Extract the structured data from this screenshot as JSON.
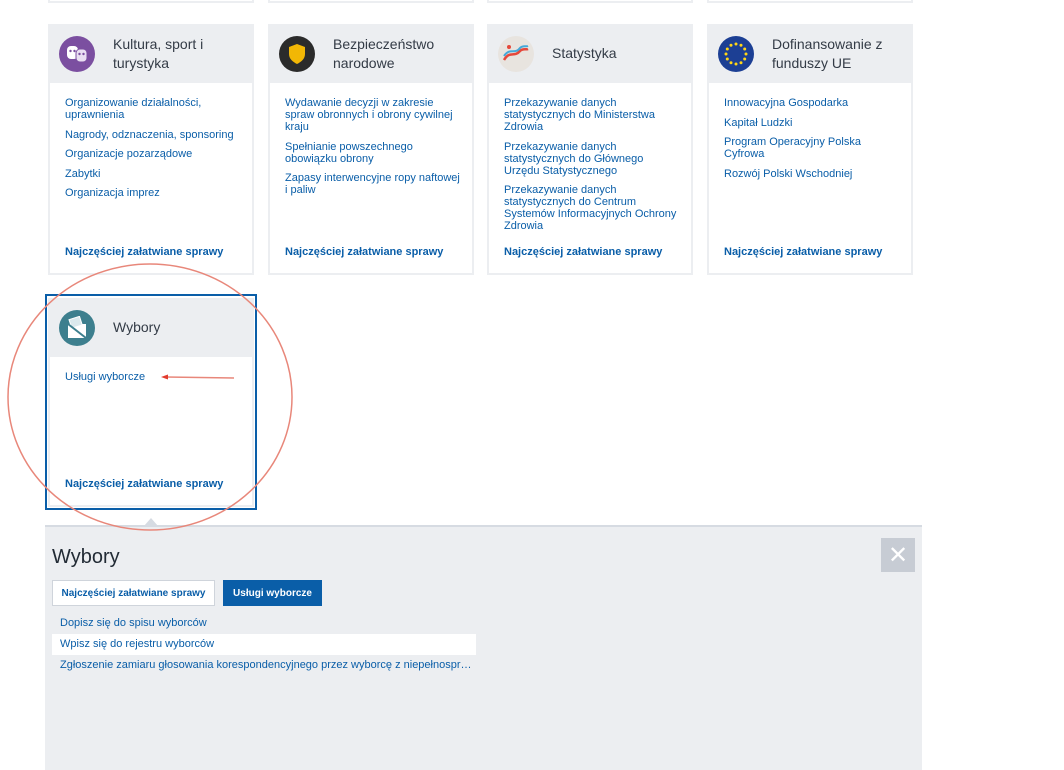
{
  "categories": [
    {
      "title": "Kultura, sport i turystyka",
      "icon": "theater-masks-icon",
      "icon_color": "#7b4fa0",
      "links": [
        "Organizowanie działalności, uprawnienia",
        "Nagrody, odznaczenia, sponsoring",
        "Organizacje pozarządowe",
        "Zabytki",
        "Organizacja imprez"
      ],
      "footer": "Najczęściej załatwiane sprawy"
    },
    {
      "title": "Bezpieczeństwo narodowe",
      "icon": "shield-icon",
      "icon_color": "#2b2b2b",
      "links": [
        "Wydawanie decyzji w zakresie spraw obronnych i obrony cywilnej kraju",
        "Spełnianie powszechnego obowiązku obrony",
        "Zapasy interwencyjne ropy naftowej i paliw"
      ],
      "footer": "Najczęściej załatwiane sprawy"
    },
    {
      "title": "Statystyka",
      "icon": "chart-lines-icon",
      "icon_color": "#e8e4df",
      "links": [
        "Przekazywanie danych statystycznych do Ministerstwa Zdrowia",
        "Przekazywanie danych statystycznych do Głównego Urzędu Statystycznego",
        "Przekazywanie danych statystycznych do Centrum Systemów Informacyjnych Ochrony Zdrowia"
      ],
      "footer": "Najczęściej załatwiane sprawy"
    },
    {
      "title": "Dofinansowanie z funduszy UE",
      "icon": "eu-flag-icon",
      "icon_color": "#1c3f94",
      "links": [
        "Innowacyjna Gospodarka",
        "Kapitał Ludzki",
        "Program Operacyjny Polska Cyfrowa",
        "Rozwój Polski Wschodniej"
      ],
      "footer": "Najczęściej załatwiane sprawy"
    }
  ],
  "selected_category": {
    "title": "Wybory",
    "icon": "ballot-box-icon",
    "icon_color": "#3d7f8e",
    "links": [
      "Usługi wyborcze"
    ],
    "footer": "Najczęściej załatwiane sprawy"
  },
  "panel": {
    "title": "Wybory",
    "tabs": [
      {
        "label": "Najczęściej załatwiane sprawy",
        "active": false
      },
      {
        "label": "Usługi wyborcze",
        "active": true
      }
    ],
    "items": [
      "Dopisz się do spisu wyborców",
      "Wpisz się do rejestru wyborców",
      "Zgłoszenie zamiaru głosowania korespondencyjnego przez wyborcę z niepełnosprawnością"
    ],
    "close_symbol": "✕"
  },
  "colors": {
    "link": "#0a5ea8",
    "header_bg": "#eceef1",
    "annotation": "#e8877a",
    "arrow": "#e23b2e"
  }
}
